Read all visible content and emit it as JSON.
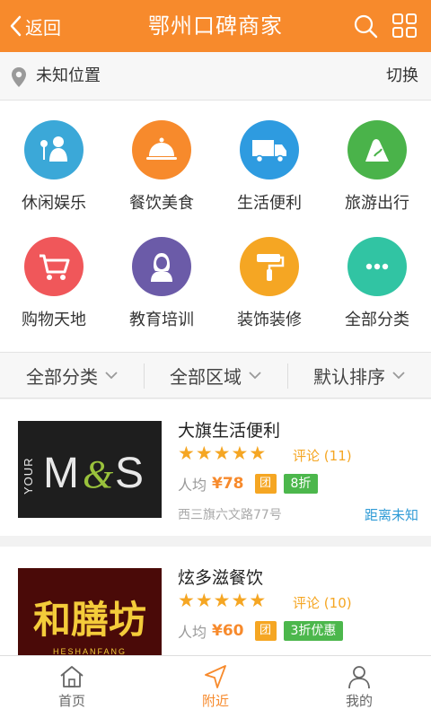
{
  "header": {
    "back_label": "返回",
    "title": "鄂州口碑商家",
    "icons": [
      "search-icon",
      "grid-icon"
    ],
    "accent": "#f78a2c"
  },
  "location": {
    "text": "未知位置",
    "switch_label": "切换"
  },
  "categories": [
    {
      "label": "休闲娱乐",
      "icon": "microphone-person-icon",
      "color": "#3ba8d8"
    },
    {
      "label": "餐饮美食",
      "icon": "food-cloche-icon",
      "color": "#f78a2c"
    },
    {
      "label": "生活便利",
      "icon": "delivery-truck-icon",
      "color": "#2e9be0"
    },
    {
      "label": "旅游出行",
      "icon": "mountain-icon",
      "color": "#4ab34a"
    },
    {
      "label": "购物天地",
      "icon": "shopping-cart-icon",
      "color": "#f0575a"
    },
    {
      "label": "教育培训",
      "icon": "teacher-icon",
      "color": "#6b5ba8"
    },
    {
      "label": "装饰装修",
      "icon": "paint-roller-icon",
      "color": "#f5a623"
    },
    {
      "label": "全部分类",
      "icon": "more-dots-icon",
      "color": "#31c4a3"
    }
  ],
  "filters": [
    {
      "label": "全部分类"
    },
    {
      "label": "全部区域"
    },
    {
      "label": "默认排序"
    }
  ],
  "listings": [
    {
      "name": "大旗生活便利",
      "thumb_text": "YOUR M&S",
      "rating_stars": 5,
      "review_label": "评论",
      "review_count": "(11)",
      "avg_label": "人均",
      "price": "¥78",
      "tuan_label": "团",
      "discount": "8折",
      "address": "西三旗六文路77号",
      "distance": "距离未知"
    },
    {
      "name": "炫多滋餐饮",
      "thumb_text": "和膳坊",
      "thumb_sub": "HESHANFANG",
      "rating_stars": 5,
      "review_label": "评论",
      "review_count": "(10)",
      "avg_label": "人均",
      "price": "¥60",
      "tuan_label": "团",
      "discount": "3折优惠",
      "address": "",
      "distance": ""
    }
  ],
  "bottom_nav": [
    {
      "label": "首页",
      "icon": "home-icon",
      "active": false
    },
    {
      "label": "附近",
      "icon": "navigation-arrow-icon",
      "active": true
    },
    {
      "label": "我的",
      "icon": "user-icon",
      "active": false
    }
  ]
}
